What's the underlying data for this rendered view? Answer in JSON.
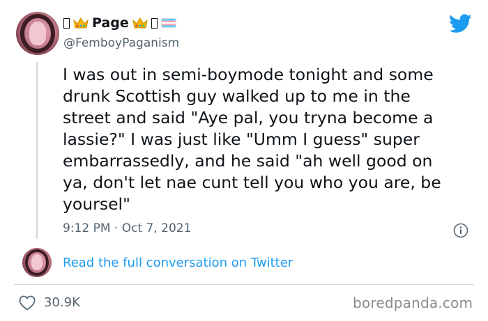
{
  "tweet": {
    "display_name": "Page",
    "handle": "@FemboyPaganism",
    "text": "I was out in semi-boymode tonight and some\ndrunk Scottish guy walked up to me in the\nstreet and said \"Aye pal, you tryna become a\nlassie?\" I was just like \"Umm I guess\" super\nembarrassedly, and he said \"ah well good on\nya, don't let nae cunt tell you who you are, be\nyoursel\"",
    "timestamp": "9:12 PM · Oct 7, 2021",
    "read_more_label": "Read the full conversation on Twitter",
    "like_count": "30.9K"
  },
  "watermark": "boredpanda.com",
  "icons": {
    "name_decorations": [
      "crown-emoji-icon",
      "transgender-flag-icon"
    ],
    "brand": "twitter-bird-icon",
    "info": "info-icon",
    "like": "heart-icon"
  },
  "colors": {
    "link_blue": "#1d9bf0",
    "twitter_blue": "#1d9bf0",
    "secondary_text": "#536471",
    "crown_gold": "#f4b400"
  }
}
